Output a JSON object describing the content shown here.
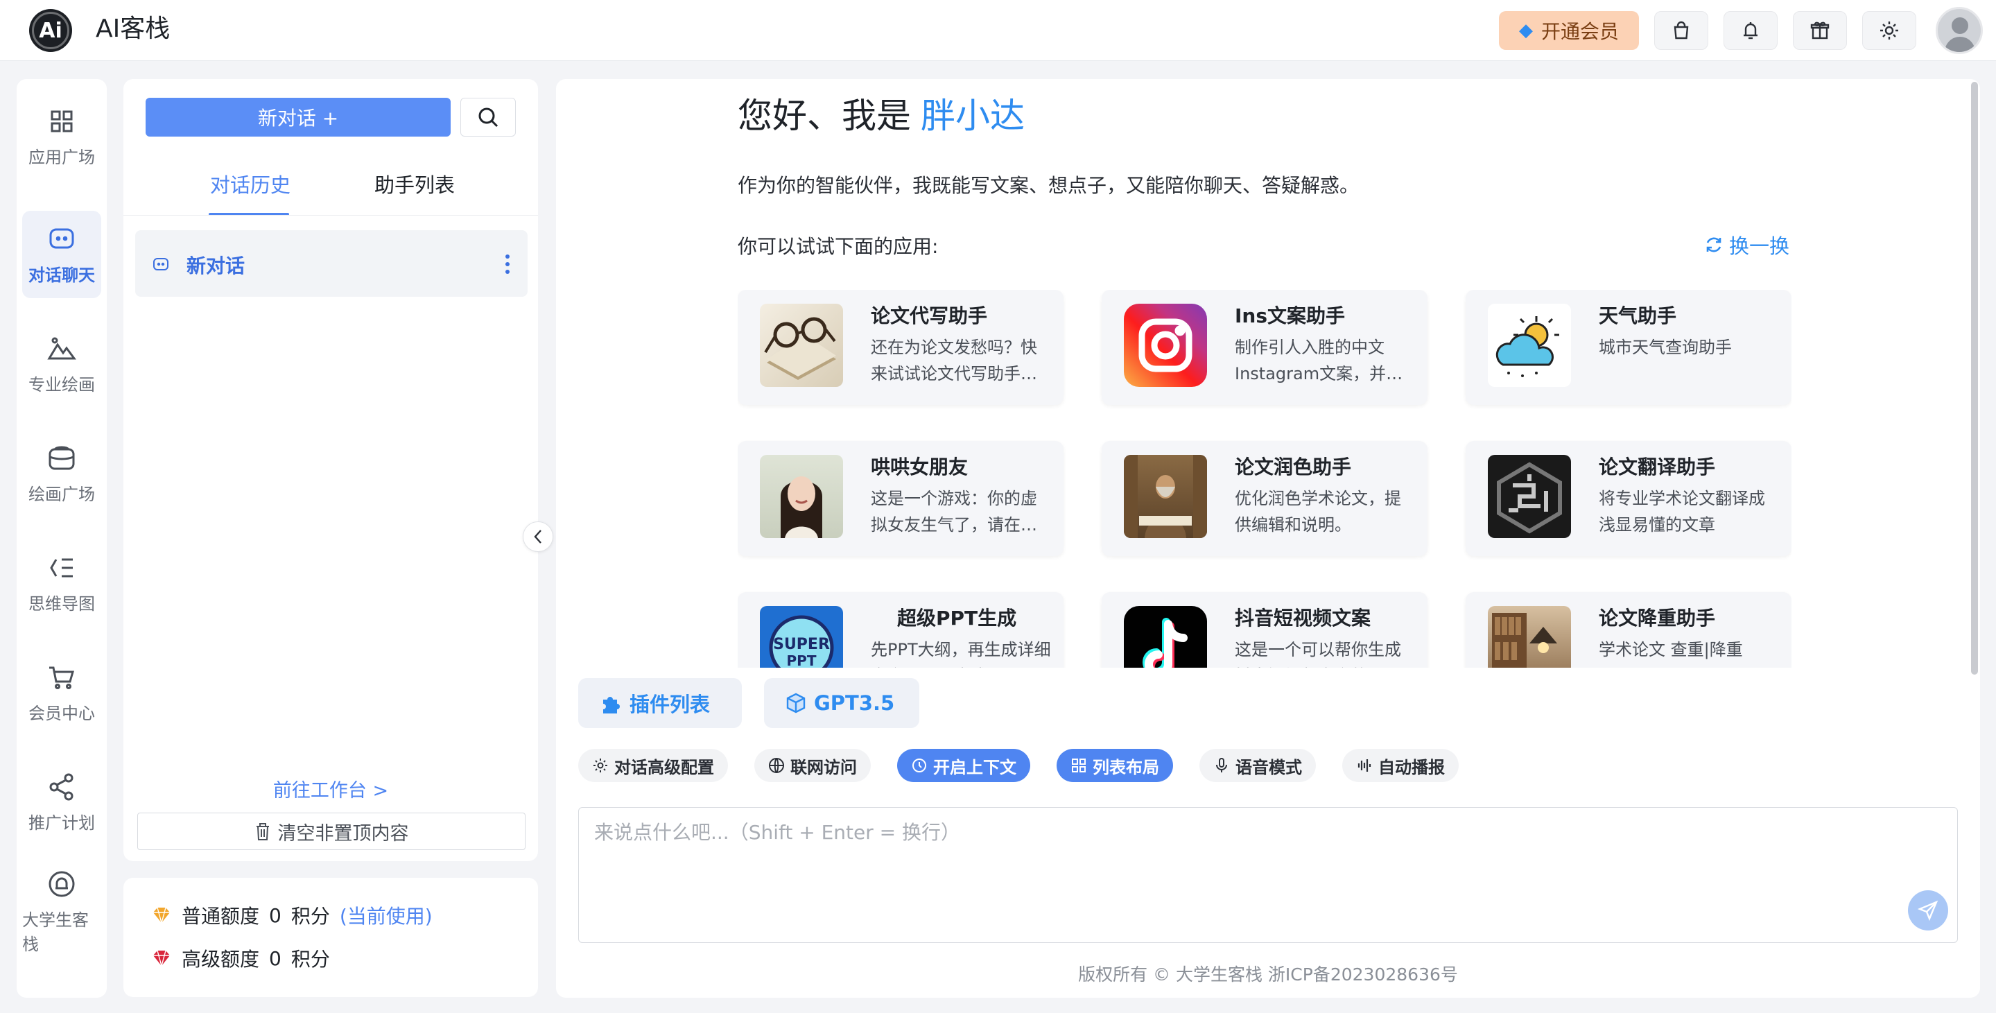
{
  "app": {
    "title": "AI客栈",
    "logo_text": "Ai"
  },
  "header": {
    "vip_label": "开通会员",
    "icons": [
      "bag-icon",
      "bell-icon",
      "gift-icon",
      "sun-icon"
    ]
  },
  "nav": {
    "items": [
      {
        "label": "应用广场",
        "icon": "grid-icon"
      },
      {
        "label": "对话聊天",
        "icon": "chat-bot-icon",
        "active": true
      },
      {
        "label": "专业绘画",
        "icon": "mountain-icon"
      },
      {
        "label": "绘画广场",
        "icon": "wallet-image-icon"
      },
      {
        "label": "思维导图",
        "icon": "mindmap-icon"
      },
      {
        "label": "会员中心",
        "icon": "cart-icon"
      },
      {
        "label": "推广计划",
        "icon": "share-icon"
      },
      {
        "label": "大学生客栈",
        "icon": "bell-circle-icon"
      }
    ]
  },
  "history": {
    "new_chat_label": "新对话 +",
    "tabs": [
      "对话历史",
      "助手列表"
    ],
    "active_tab": 0,
    "conversations": [
      {
        "title": "新对话"
      }
    ],
    "goto_workspace": "前往工作台 >",
    "clear_label": "清空非置顶内容"
  },
  "quota": {
    "normal": {
      "label": "普通额度",
      "value": "0",
      "unit": "积分",
      "note": "(当前使用)",
      "color": "#f2a62c"
    },
    "advanced": {
      "label": "高级额度",
      "value": "0",
      "unit": "积分",
      "color": "#d9263b"
    }
  },
  "main": {
    "greeting_prefix": "您好、我是",
    "assistant_name": "胖小达",
    "intro": "作为你的智能伙伴，我既能写文案、想点子，又能陪你聊天、答疑解惑。",
    "try_label": "你可以试试下面的应用:",
    "refresh_label": "换一换",
    "cards": [
      {
        "title": "论文代写助手",
        "desc": "还在为论文发愁吗？快来试试论文代写助手…",
        "thumb": "glasses-book"
      },
      {
        "title": "Ins文案助手",
        "desc": "制作引人入胜的中文Instagram文案，并…",
        "thumb": "instagram"
      },
      {
        "title": "天气助手",
        "desc": "城市天气查询助手",
        "thumb": "weather"
      },
      {
        "title": "哄哄女朋友",
        "desc": "这是一个游戏：你的虚拟女友生气了，请在…",
        "thumb": "girl-portrait"
      },
      {
        "title": "论文润色助手",
        "desc": "优化润色学术论文，提供编辑和说明。",
        "thumb": "scholar"
      },
      {
        "title": "论文翻译助手",
        "desc": "将专业学术论文翻译成浅显易懂的文章",
        "thumb": "maze-cube"
      },
      {
        "title": "超级PPT生成",
        "desc": "先PPT大纲，再生成详细文案，最后生成…",
        "thumb": "ppt"
      },
      {
        "title": "抖音短视频文案",
        "desc": "这是一个可以帮你生成抖音短视频文案的…",
        "thumb": "tiktok"
      },
      {
        "title": "论文降重助手",
        "desc": "学术论文 查重|降重",
        "thumb": "library"
      }
    ],
    "plugin_label": "插件列表",
    "model_label": "GPT3.5",
    "chips": [
      {
        "label": "对话高级配置",
        "icon": "gear-icon",
        "on": false
      },
      {
        "label": "联网访问",
        "icon": "globe-icon",
        "on": false
      },
      {
        "label": "开启上下文",
        "icon": "clock-icon",
        "on": true
      },
      {
        "label": "列表布局",
        "icon": "grid-icon",
        "on": true
      },
      {
        "label": "语音模式",
        "icon": "microphone-icon",
        "on": false
      },
      {
        "label": "自动播报",
        "icon": "waveform-icon",
        "on": false
      }
    ],
    "input_placeholder": "来说点什么吧...（Shift + Enter = 换行）",
    "footer": "版权所有 © 大学生客栈   浙ICP备2023028636号"
  }
}
